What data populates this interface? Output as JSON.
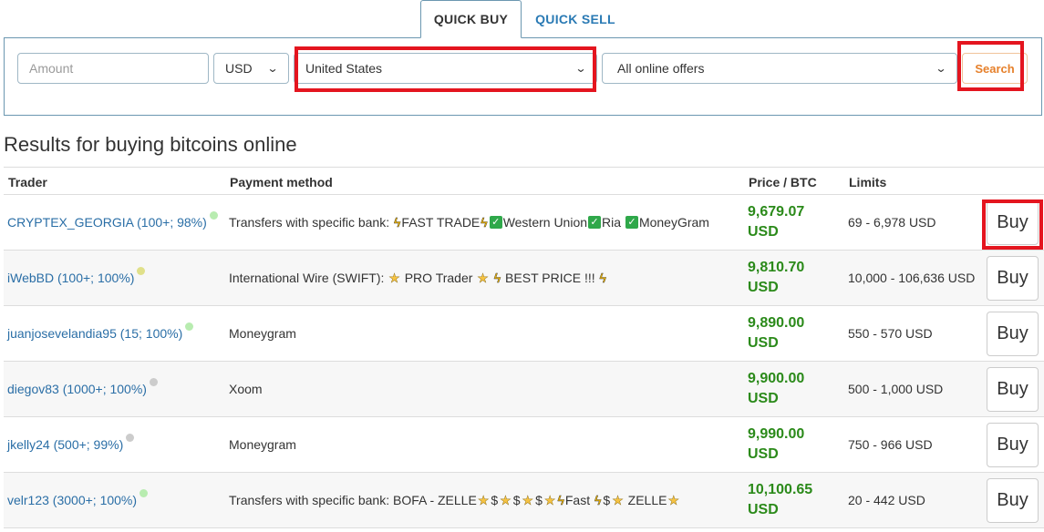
{
  "tabs": {
    "quick_buy": "QUICK BUY",
    "quick_sell": "QUICK SELL"
  },
  "search": {
    "amount_placeholder": "Amount",
    "currency_value": "USD",
    "country_value": "United States",
    "offers_value": "All online offers",
    "search_label": "Search"
  },
  "results": {
    "heading": "Results for buying bitcoins online"
  },
  "table": {
    "headers": {
      "trader": "Trader",
      "payment": "Payment method",
      "price": "Price / BTC",
      "limits": "Limits"
    },
    "buy_label": "Buy",
    "rows": [
      {
        "trader": "CRYPTEX_GEORGIA (100+; 98%)",
        "status_color": "#b8ecb0",
        "payment_prefix": "Transfers with specific bank: ",
        "payment_parts": [
          "bolt",
          "FAST TRADE",
          "bolt",
          "check",
          "Western Union",
          "check",
          "Ria ",
          "check",
          "MoneyGram"
        ],
        "price": "9,679.07",
        "price_currency": "USD",
        "limits": "69 - 6,978 USD"
      },
      {
        "trader": "iWebBD (100+; 100%)",
        "status_color": "#e0e08a",
        "payment_prefix": "International Wire (SWIFT): ",
        "payment_parts": [
          "star",
          " PRO Trader ",
          "star",
          " ",
          "bolt",
          " BEST PRICE !!! ",
          "bolt"
        ],
        "price": "9,810.70",
        "price_currency": "USD",
        "limits": "10,000 - 106,636 USD"
      },
      {
        "trader": "juanjosevelandia95 (15; 100%)",
        "status_color": "#b8ecb0",
        "payment_prefix": "Moneygram",
        "payment_parts": [],
        "price": "9,890.00",
        "price_currency": "USD",
        "limits": "550 - 570 USD"
      },
      {
        "trader": "diegov83 (1000+; 100%)",
        "status_color": "#cccccc",
        "payment_prefix": "Xoom",
        "payment_parts": [],
        "price": "9,900.00",
        "price_currency": "USD",
        "limits": "500 - 1,000 USD"
      },
      {
        "trader": "jkelly24 (500+; 99%)",
        "status_color": "#cccccc",
        "payment_prefix": "Moneygram",
        "payment_parts": [],
        "price": "9,990.00",
        "price_currency": "USD",
        "limits": "750 - 966 USD"
      },
      {
        "trader": "velr123 (3000+; 100%)",
        "status_color": "#b8ecb0",
        "payment_prefix": "Transfers with specific bank: BOFA - ZELLE",
        "payment_parts": [
          "star",
          "dollar",
          "star",
          "dollar",
          "star",
          "dollar",
          "star",
          "bolt",
          "Fast ",
          "bolt",
          "dollar",
          "star",
          " ZELLE",
          "star"
        ],
        "price": "10,100.65",
        "price_currency": "USD",
        "limits": "20 - 442 USD"
      }
    ]
  },
  "colors": {
    "accent_blue": "#2a7ab4",
    "price_green": "#2b8a1a",
    "search_orange": "#e6802b",
    "highlight_red": "#e4151f"
  }
}
